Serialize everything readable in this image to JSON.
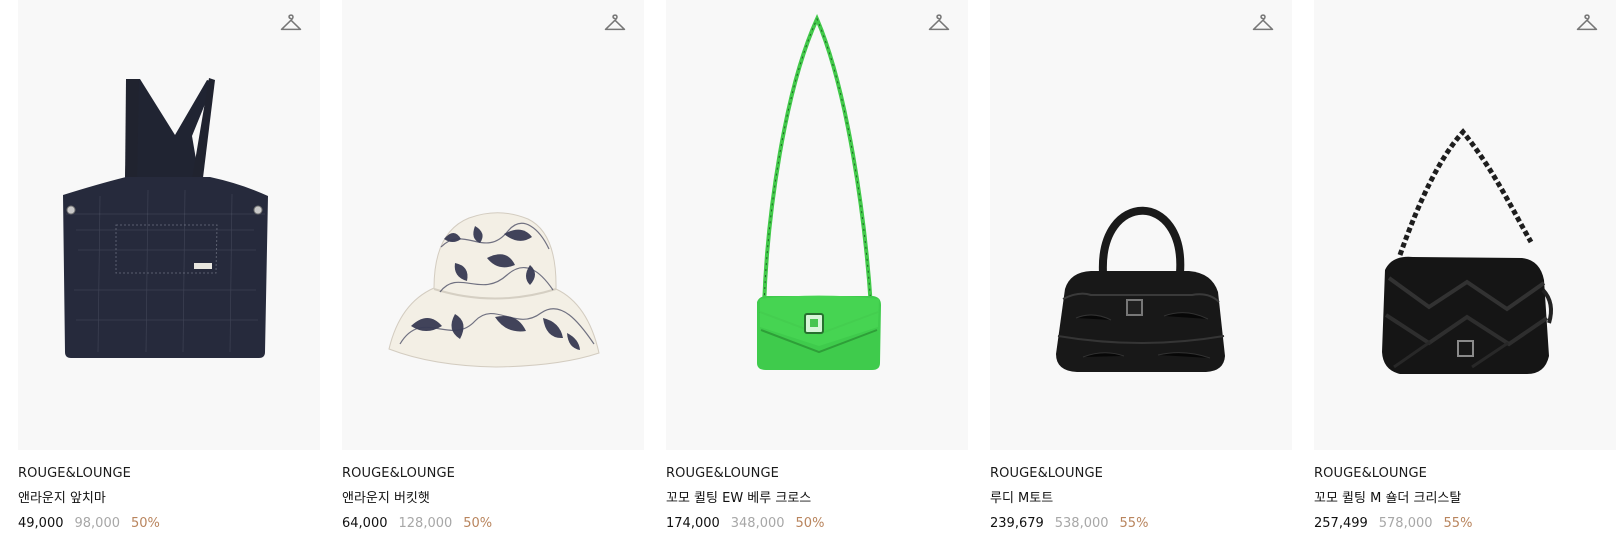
{
  "products": [
    {
      "brand": "ROUGE&LOUNGE",
      "name": "앤라운지 앞치마",
      "price": "49,000",
      "original_price": "98,000",
      "discount": "50%"
    },
    {
      "brand": "ROUGE&LOUNGE",
      "name": "앤라운지 버킷햇",
      "price": "64,000",
      "original_price": "128,000",
      "discount": "50%"
    },
    {
      "brand": "ROUGE&LOUNGE",
      "name": "꼬모 퀼팅 EW 베루 크로스",
      "price": "174,000",
      "original_price": "348,000",
      "discount": "50%"
    },
    {
      "brand": "ROUGE&LOUNGE",
      "name": "루디 M토트",
      "price": "239,679",
      "original_price": "538,000",
      "discount": "55%"
    },
    {
      "brand": "ROUGE&LOUNGE",
      "name": "꼬모 퀼팅 M 숄더 크리스탈",
      "price": "257,499",
      "original_price": "578,000",
      "discount": "55%"
    }
  ],
  "colors": {
    "image_background": "#f8f8f8",
    "original_price": "#a7a7a7",
    "discount": "#b9855e",
    "green_bag": "#3fcb4c",
    "black_bag": "#151515",
    "navy_apron": "#25283a"
  },
  "icons": {
    "wishlist": "hanger-icon"
  }
}
